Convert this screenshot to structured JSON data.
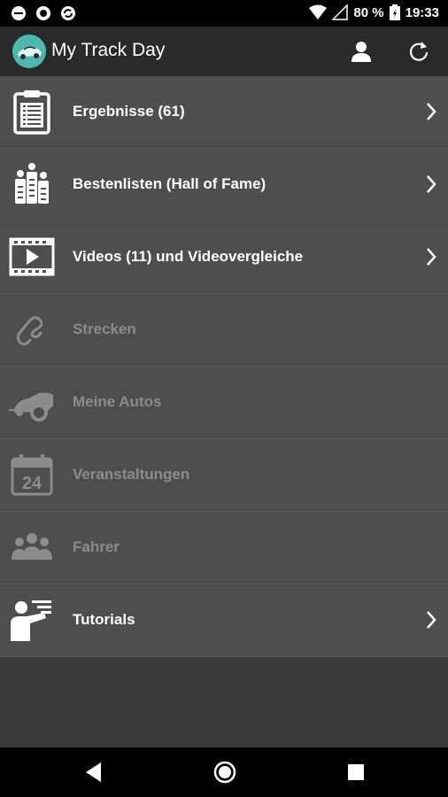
{
  "status_bar": {
    "battery": "80 %",
    "time": "19:33"
  },
  "app_bar": {
    "title": "My Track Day",
    "actions": [
      "profile-icon",
      "refresh-icon"
    ]
  },
  "menu": {
    "items": [
      {
        "label": "Ergebnisse (61)",
        "icon": "clipboard-icon",
        "enabled": true,
        "chevron": true
      },
      {
        "label": "Bestenlisten (Hall of Fame)",
        "icon": "leaderboard-icon",
        "enabled": true,
        "chevron": true
      },
      {
        "label": "Videos (11) und Videovergleiche",
        "icon": "video-icon",
        "enabled": true,
        "chevron": true
      },
      {
        "label": "Strecken",
        "icon": "track-icon",
        "enabled": false,
        "chevron": false
      },
      {
        "label": "Meine Autos",
        "icon": "car-icon",
        "enabled": false,
        "chevron": false
      },
      {
        "label": "Veranstaltungen",
        "icon": "calendar-icon",
        "enabled": false,
        "chevron": false
      },
      {
        "label": "Fahrer",
        "icon": "drivers-icon",
        "enabled": false,
        "chevron": false
      },
      {
        "label": "Tutorials",
        "icon": "presenter-icon",
        "enabled": true,
        "chevron": true
      }
    ],
    "calendar_day": "24"
  },
  "colors": {
    "status_bar": "#000000",
    "app_bar": "#2a2a2a",
    "menu_item": "#4e4e4e",
    "background": "#3b3b3b",
    "enabled_text": "#ffffff",
    "disabled_text": "#8c8c8c",
    "logo": "#4db8b0"
  }
}
